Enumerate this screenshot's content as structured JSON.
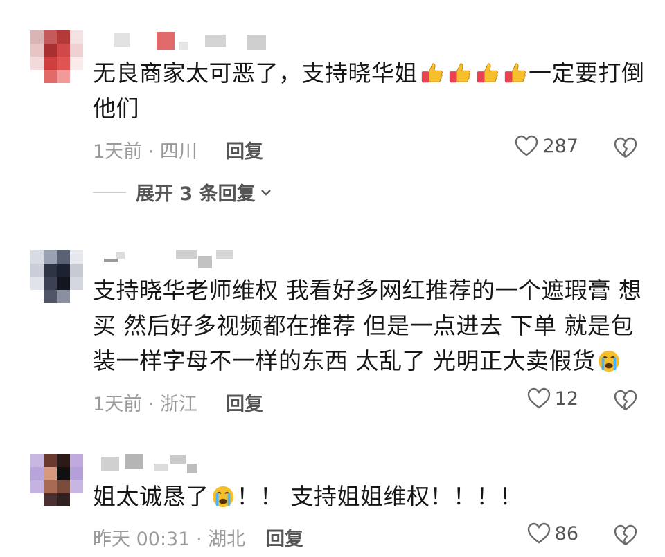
{
  "comments": [
    {
      "text_part1": "无良商家太可恶了，支持晓华姐",
      "text_part2": "一定要打倒他们",
      "time_location": "1天前 · 四川",
      "reply_label": "回复",
      "like_count": "287",
      "expand_label": "展开 3 条回复",
      "emojis": [
        "thumbs-up",
        "thumbs-up",
        "thumbs-up",
        "thumbs-up"
      ]
    },
    {
      "text_part1": "支持晓华老师维权 我看好多网红推荐的一个遮瑕膏 想买 然后好多视频都在推荐 但是一点进去 下单 就是包装一样字母不一样的东西 太乱了 光明正大卖假货",
      "time_location": "1天前 · 浙江",
      "reply_label": "回复",
      "like_count": "12",
      "emojis": [
        "crying-face"
      ]
    },
    {
      "text_part1": "姐太诚恳了",
      "text_part2": "！！ 支持姐姐维权！！！！",
      "time_location": "昨天 00:31 · 湖北",
      "reply_label": "回复",
      "like_count": "86",
      "emojis": [
        "crying-face"
      ]
    }
  ],
  "colors": {
    "text": "#161616",
    "meta": "#9a9a9a",
    "action": "#555555",
    "emoji_yellow": "#f6c02c"
  }
}
